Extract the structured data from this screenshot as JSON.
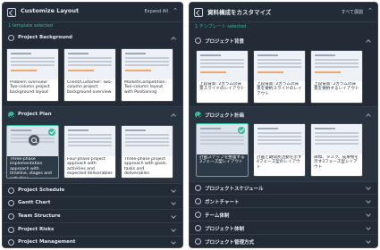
{
  "left": {
    "title": "Customize Layout",
    "filter": "Expand All",
    "selected": "1 template selected",
    "sections": [
      {
        "label": "Project Background"
      },
      {
        "label": "Project Plan"
      },
      {
        "label": "Project Schedule"
      },
      {
        "label": "Gantt Chart"
      },
      {
        "label": "Team Structure"
      },
      {
        "label": "Project Risks"
      },
      {
        "label": "Project Management"
      }
    ],
    "bg_cards": [
      "Problem overview: Two-column project background layout",
      "Client/Customer: Two-column project background overview",
      "Market/Competition: Two-column layout with Positioning"
    ],
    "plan_cards": [
      "Three-phase implementation approach with timeline, stages and activities",
      "Four-phase project approach with activities and expected deliverables",
      "Three-phase project approach with goals, tasks and deliverables"
    ]
  },
  "right": {
    "title": "資料構成をカスタマイズ",
    "filter": "すべて展開",
    "selected": "1 テンプレート selected",
    "sections": [
      {
        "label": "プロジェクト背景"
      },
      {
        "label": "プロジェクト計画"
      },
      {
        "label": "プロジェクトスケジュール"
      },
      {
        "label": "ガントチャート"
      },
      {
        "label": "チーム体制"
      },
      {
        "label": "プロジェクト体制"
      },
      {
        "label": "プロジェクト管理方式"
      }
    ],
    "bg_cards": [
      "上段背景: 2カラムの背景スライドのレイアウト",
      "上段背景: 2カラムの背景を要約スライドのレイアウト",
      "上段背景: 2カラムの背景を要約するレイアウト"
    ],
    "plan_cards": [
      "計画ステップを整理する3フェーズ型レイアウト",
      "計画と期間別活動を示す4フェーズ型のレイアウト",
      "目標、タスク、成果物を示す3フェーズ型レイアウト"
    ]
  },
  "colors": {
    "accent": "#2fbf9f",
    "panel": "#232b36"
  }
}
